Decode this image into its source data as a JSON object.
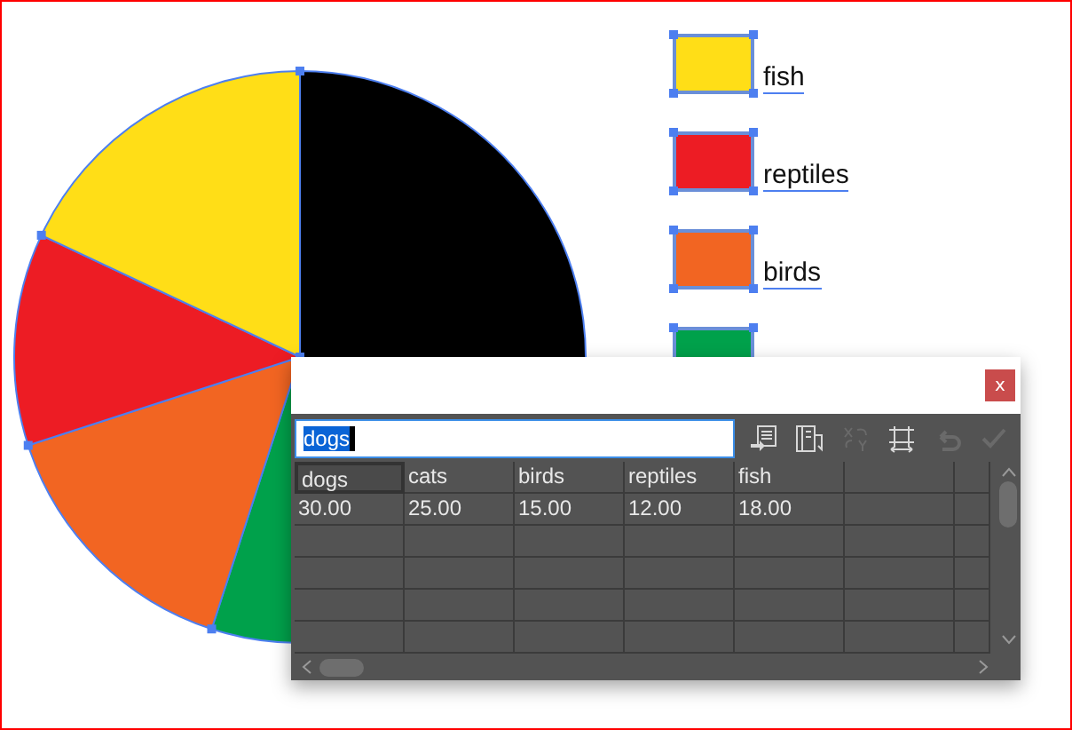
{
  "artboard": {
    "pie_slices": [
      {
        "color": "#000000"
      },
      {
        "color": "#00a14b"
      },
      {
        "color": "#f26522"
      },
      {
        "color": "#ed1c24"
      },
      {
        "color": "#ffde17"
      }
    ],
    "legend": [
      {
        "label": "fish",
        "color": "#ffde17"
      },
      {
        "label": "reptiles",
        "color": "#ed1c24"
      },
      {
        "label": "birds",
        "color": "#f26522"
      },
      {
        "color": "#00a14b"
      }
    ]
  },
  "data_window": {
    "close_label": "x",
    "cell_field": {
      "value": "dogs",
      "text_highlighted": true
    },
    "tools": [
      {
        "kind": "import",
        "disabled": false
      },
      {
        "kind": "transpose",
        "disabled": false
      },
      {
        "kind": "swap",
        "disabled": true
      },
      {
        "kind": "cellstyle",
        "disabled": false
      },
      {
        "kind": "revert",
        "disabled": true
      },
      {
        "kind": "apply",
        "disabled": true
      }
    ],
    "rows": [
      {
        "cells": [
          {
            "text": "dogs",
            "selected": true
          },
          {
            "text": "cats",
            "selected": false
          },
          {
            "text": "birds",
            "selected": false
          },
          {
            "text": "reptiles",
            "selected": false
          },
          {
            "text": "fish",
            "selected": false
          }
        ]
      },
      {
        "cells": [
          {
            "text": "30.00",
            "selected": false
          },
          {
            "text": "25.00",
            "selected": false
          },
          {
            "text": "15.00",
            "selected": false
          },
          {
            "text": "12.00",
            "selected": false
          },
          {
            "text": "18.00",
            "selected": false
          }
        ]
      }
    ]
  }
}
